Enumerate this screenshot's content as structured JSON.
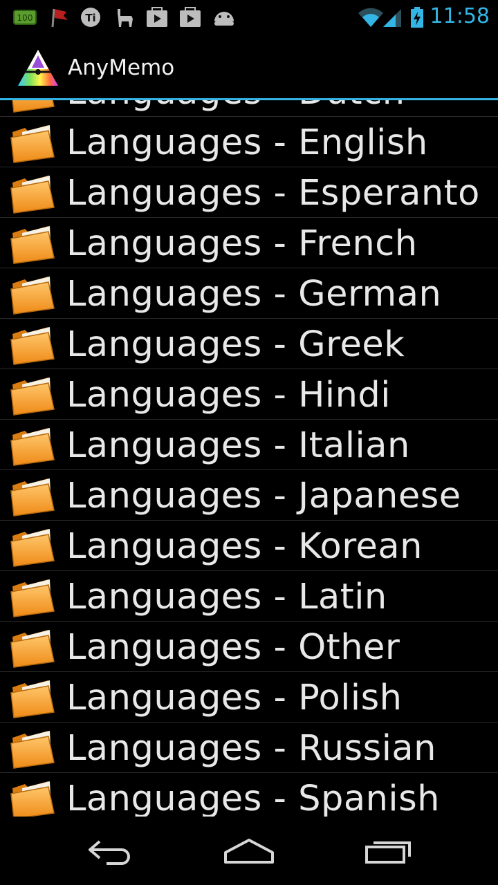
{
  "status_bar": {
    "time": "11:58",
    "battery_badge": "100",
    "icons": [
      "battery-100-icon",
      "flag-icon",
      "ti-icon",
      "llama-icon",
      "play-store-icon",
      "play-store-icon",
      "android-icon",
      "wifi-icon",
      "signal-icon",
      "battery-charging-icon"
    ]
  },
  "action_bar": {
    "title": "AnyMemo",
    "accent_color": "#33b5e5"
  },
  "list": {
    "items": [
      {
        "label": "Languages - Dutch"
      },
      {
        "label": "Languages - English"
      },
      {
        "label": "Languages - Esperanto"
      },
      {
        "label": "Languages - French"
      },
      {
        "label": "Languages - German"
      },
      {
        "label": "Languages - Greek"
      },
      {
        "label": "Languages - Hindi"
      },
      {
        "label": "Languages - Italian"
      },
      {
        "label": "Languages - Japanese"
      },
      {
        "label": "Languages - Korean"
      },
      {
        "label": "Languages - Latin"
      },
      {
        "label": "Languages - Other"
      },
      {
        "label": "Languages - Polish"
      },
      {
        "label": "Languages - Russian"
      },
      {
        "label": "Languages - Spanish"
      }
    ]
  },
  "nav_bar": {
    "buttons": [
      "back-icon",
      "home-icon",
      "recent-apps-icon"
    ]
  }
}
